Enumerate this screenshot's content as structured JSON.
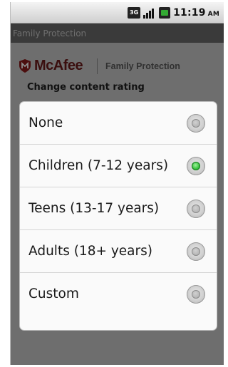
{
  "status_bar": {
    "network_label": "3G",
    "time": "11:19",
    "ampm": "AM"
  },
  "app": {
    "title": "Family Protection"
  },
  "brand": {
    "name": "McAfee",
    "product": "Family Protection",
    "logo_icon": "mcafee-shield-icon"
  },
  "content": {
    "section_label": "Change content rating"
  },
  "dialog": {
    "options": [
      {
        "label": "None",
        "selected": false
      },
      {
        "label": "Children (7-12 years)",
        "selected": true
      },
      {
        "label": "Teens (13-17 years)",
        "selected": false
      },
      {
        "label": "Adults (18+ years)",
        "selected": false
      },
      {
        "label": "Custom",
        "selected": false
      }
    ]
  },
  "colors": {
    "brand_red": "#8b1a1a",
    "radio_selected": "#36c03c"
  }
}
